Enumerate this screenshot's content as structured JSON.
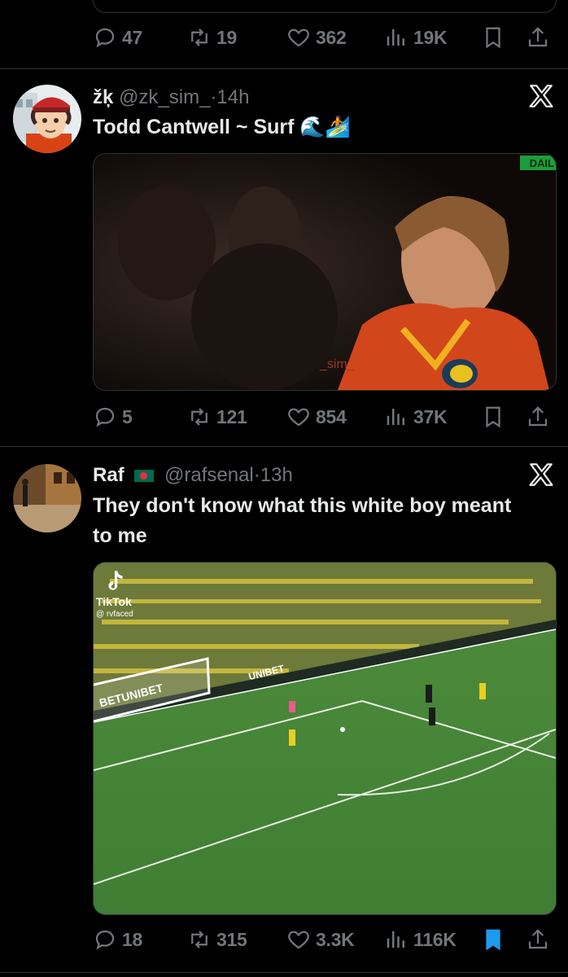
{
  "colors": {
    "background": "#000000",
    "muted": "#71767b",
    "text": "#e7e9ea",
    "bookmark_active": "#1d9bf0",
    "divider": "#2f3336"
  },
  "tweets": [
    {
      "actions": {
        "replies": "47",
        "retweets": "19",
        "likes": "362",
        "views": "19K",
        "bookmarked": false
      }
    },
    {
      "display_name": "žķ",
      "handle": "@zk_sim_",
      "separator": "·",
      "time": "14h",
      "text": "Todd Cantwell ~ Surf 🌊🏄",
      "media": {
        "type": "video",
        "watermark": "DAIL",
        "overlay_text": "_sim_"
      },
      "actions": {
        "replies": "5",
        "retweets": "121",
        "likes": "854",
        "views": "37K",
        "bookmarked": false
      }
    },
    {
      "display_name": "Raf",
      "handle": "@rafsenal",
      "separator": "·",
      "time": "13h",
      "text": "They don't know what this white boy meant to me",
      "media": {
        "type": "video",
        "brand": "TikTok",
        "brand_handle": "@ rvfaced",
        "ad_text": [
          "BETUNIBET",
          "UNIBET"
        ]
      },
      "actions": {
        "replies": "18",
        "retweets": "315",
        "likes": "3.3K",
        "views": "116K",
        "bookmarked": true
      }
    }
  ]
}
